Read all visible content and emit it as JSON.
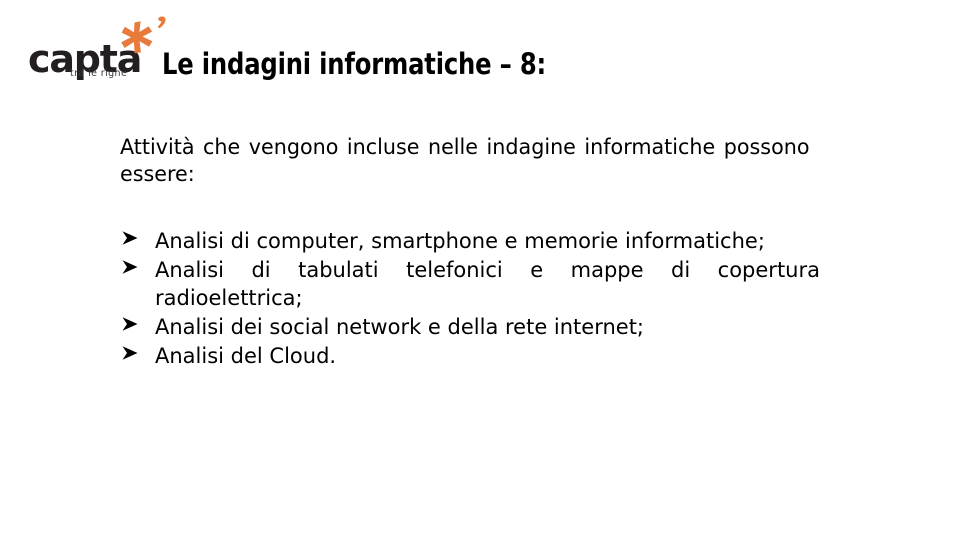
{
  "logo": {
    "wordmark": "capta",
    "tagline": "tra le righe",
    "star_icon": "asterisk-icon",
    "accent_color": "#E87A3C",
    "wordmark_color": "#231F20"
  },
  "slide": {
    "title": "Le indagini informatiche – 8:",
    "intro": "Attività che vengono incluse nelle indagine informatiche possono essere:",
    "bullet_marker": "➢",
    "bullets": [
      "Analisi di computer, smartphone e memorie informatiche;",
      "Analisi di tabulati telefonici e mappe di copertura radioelettrica;",
      "Analisi dei social network e della rete internet;",
      "Analisi del Cloud."
    ],
    "background_color": "#FFFFFF",
    "text_color": "#000000"
  }
}
